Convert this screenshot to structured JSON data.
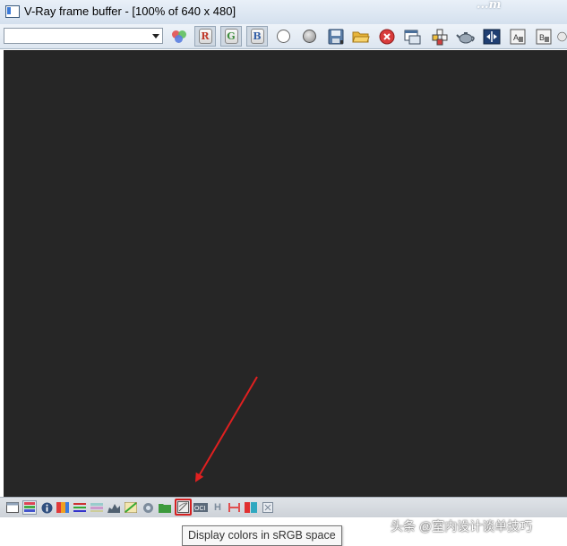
{
  "window": {
    "title": "V-Ray frame buffer - [100% of 640 x 480]"
  },
  "logo": {
    "text": "...m"
  },
  "toolbar": {
    "channel_dropdown": {
      "value": ""
    },
    "buttons": [
      {
        "name": "color-mode-button",
        "icon": "rgb-balls-icon"
      },
      {
        "name": "red-channel-button",
        "label": "R",
        "color": "#c0392b",
        "pressed": true
      },
      {
        "name": "green-channel-button",
        "label": "G",
        "color": "#3e8e3e",
        "pressed": true
      },
      {
        "name": "blue-channel-button",
        "label": "B",
        "color": "#3560a8",
        "pressed": true
      },
      {
        "name": "view-white-button",
        "icon": "white-circle-icon"
      },
      {
        "name": "view-gray-button",
        "icon": "gray-sphere-icon"
      },
      {
        "name": "save-image-button",
        "icon": "floppy-disk-icon"
      },
      {
        "name": "load-image-button",
        "icon": "folder-open-icon"
      },
      {
        "name": "clear-image-button",
        "icon": "red-x-icon"
      },
      {
        "name": "duplicate-to-max-button",
        "icon": "window-copy-icon"
      },
      {
        "name": "track-mouse-button",
        "icon": "crosshair-icon"
      },
      {
        "name": "render-teapot-button",
        "icon": "teapot-icon"
      },
      {
        "name": "ab-compare-button",
        "icon": "compare-icon"
      },
      {
        "name": "history-a-button",
        "icon": "history-a-icon"
      },
      {
        "name": "history-b-button",
        "icon": "history-b-icon"
      },
      {
        "name": "more-button",
        "icon": "overflow-icon"
      }
    ]
  },
  "bottom_bar": {
    "buttons": [
      "window-icon",
      "pixel-info-icon",
      "info-icon",
      "color-clamp-icon",
      "levels-icon",
      "curve-icon",
      "histogram-icon",
      "exposure-icon",
      "lens-effects-icon",
      "lut-icon",
      "srgb-space-icon",
      "ocio-icon",
      "h-icon",
      "split-icon",
      "stereo-icon",
      "pin-icon"
    ],
    "highlighted": "srgb-space-icon"
  },
  "tooltip": {
    "text": "Display colors in sRGB space"
  },
  "watermark": {
    "text": "头条 @室内设计谈单技巧"
  },
  "colors": {
    "canvas": "#262626",
    "annotation_arrow": "#e02020"
  }
}
